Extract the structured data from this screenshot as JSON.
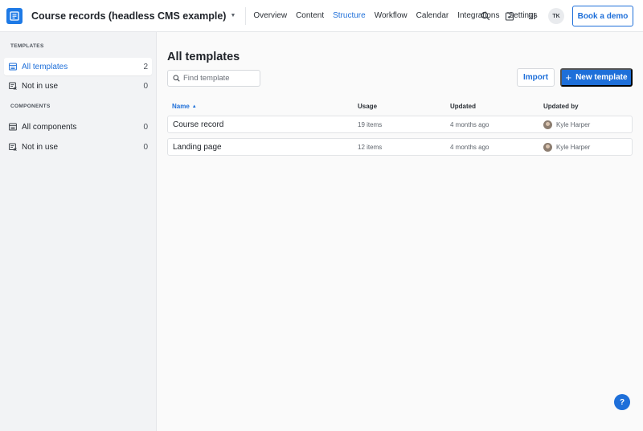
{
  "header": {
    "project_title": "Course records (headless CMS example)",
    "nav": [
      "Overview",
      "Content",
      "Structure",
      "Workflow",
      "Calendar",
      "Integrations",
      "Settings"
    ],
    "active_nav": "Structure",
    "avatar_initials": "TK",
    "demo_label": "Book a demo",
    "accent_color": "#1e6fd9"
  },
  "sidebar": {
    "templates_heading": "TEMPLATES",
    "components_heading": "COMPONENTS",
    "templates": [
      {
        "label": "All templates",
        "count": "2",
        "icon": "list-icon"
      },
      {
        "label": "Not in use",
        "count": "0",
        "icon": "unused-list-icon"
      }
    ],
    "components": [
      {
        "label": "All components",
        "count": "0",
        "icon": "list-icon"
      },
      {
        "label": "Not in use",
        "count": "0",
        "icon": "unused-list-icon"
      }
    ]
  },
  "main": {
    "title": "All templates",
    "search_placeholder": "Find template",
    "import_label": "Import",
    "new_label": "New template",
    "columns": {
      "name": "Name",
      "usage": "Usage",
      "updated": "Updated",
      "updated_by": "Updated by"
    },
    "rows": [
      {
        "name": "Course record",
        "usage": "19 items",
        "updated": "4 months ago",
        "updated_by": "Kyle Harper"
      },
      {
        "name": "Landing page",
        "usage": "12 items",
        "updated": "4 months ago",
        "updated_by": "Kyle Harper"
      }
    ]
  },
  "help_label": "?"
}
